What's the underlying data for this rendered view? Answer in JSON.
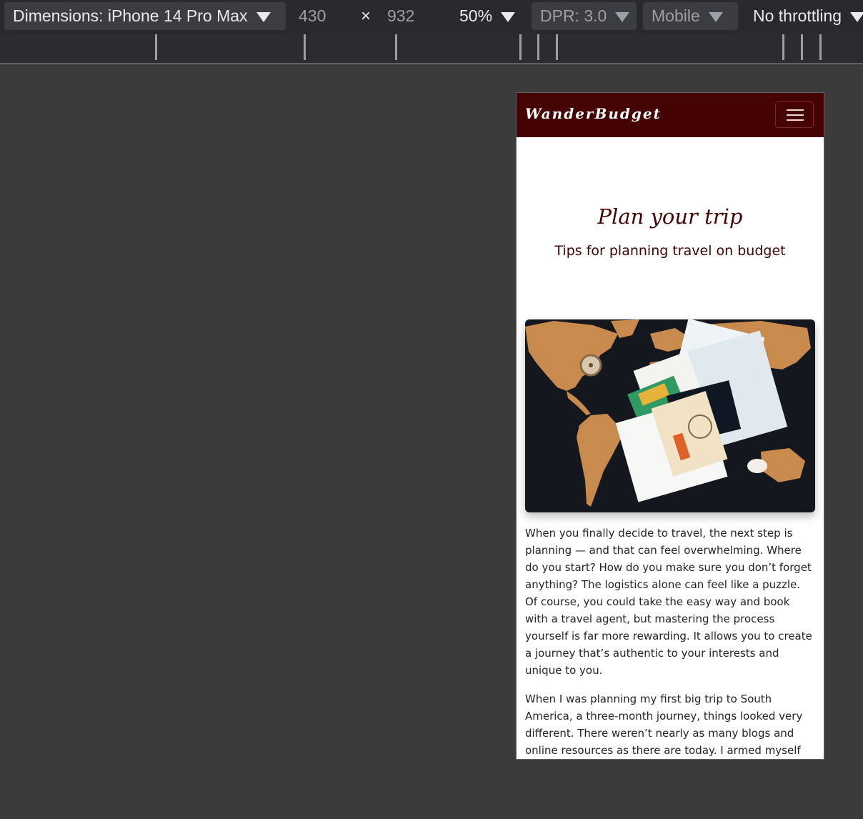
{
  "devtools": {
    "dimensions_label": "Dimensions: iPhone 14 Pro Max",
    "width": "430",
    "times": "×",
    "height": "932",
    "zoom": "50%",
    "dpr": "DPR: 3.0",
    "device_type": "Mobile",
    "throttling": "No throttling"
  },
  "page": {
    "brand": "WanderBudget",
    "hero_title": "Plan your trip",
    "hero_subtitle": "Tips for planning travel on budget",
    "paragraphs": [
      "When you finally decide to travel, the next step is planning — and that can feel overwhelming. Where do you start? How do you make sure you don’t forget anything? The logistics alone can feel like a puzzle. Of course, you could take the easy way and book with a travel agent, but mastering the process yourself is far more rewarding. It allows you to create a journey that’s authentic to your interests and unique to you.",
      "When I was planning my first big trip to South America, a three-month journey, things looked very different. There weren’t nearly as many blogs and online resources as there are today. I armed myself with Lonely Planet and Rough Guide books, marked"
    ]
  },
  "colors": {
    "nav_background": "#460303",
    "accent_text": "#460303",
    "body_text": "#212529",
    "devtools_background": "#292a2d",
    "canvas_background": "#3b3b3b"
  },
  "icons": {
    "menu": "hamburger-menu-icon",
    "dropdown": "caret-down-icon",
    "close": "times-icon"
  }
}
